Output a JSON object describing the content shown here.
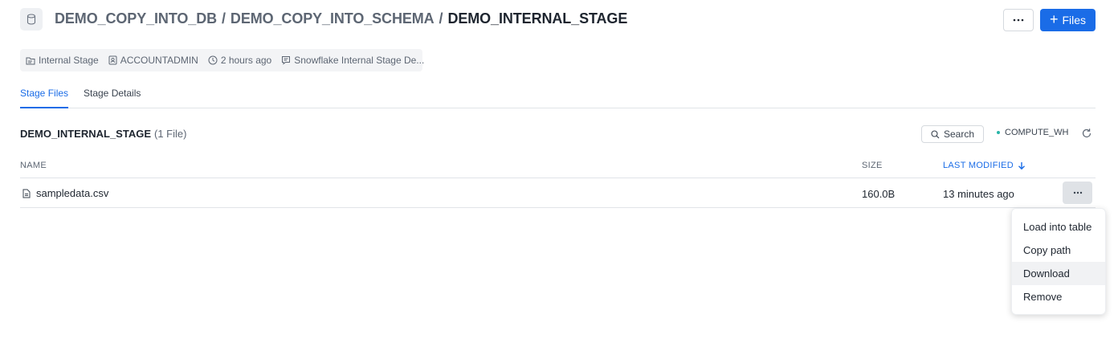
{
  "header": {
    "crumbs": [
      "DEMO_COPY_INTO_DB",
      "DEMO_COPY_INTO_SCHEMA"
    ],
    "separator": "/",
    "current": "DEMO_INTERNAL_STAGE",
    "more_label": "···",
    "files_button": {
      "icon": "+",
      "label": "Files"
    }
  },
  "meta": {
    "type": "Internal Stage",
    "owner": "ACCOUNTADMIN",
    "created": "2 hours ago",
    "comment": "Snowflake Internal Stage De..."
  },
  "tabs": [
    {
      "label": "Stage Files",
      "active": true
    },
    {
      "label": "Stage Details",
      "active": false
    }
  ],
  "section": {
    "title": "DEMO_INTERNAL_STAGE",
    "count": "(1 File)",
    "search_label": "Search",
    "warehouse": "COMPUTE_WH"
  },
  "table": {
    "columns": {
      "name": "NAME",
      "size": "SIZE",
      "modified": "LAST MODIFIED"
    },
    "rows": [
      {
        "name": "sampledata.csv",
        "size": "160.0B",
        "modified": "13 minutes ago"
      }
    ]
  },
  "row_menu": {
    "items": [
      "Load into table",
      "Copy path",
      "Download",
      "Remove"
    ],
    "highlighted": "Download"
  },
  "colors": {
    "accent": "#1a6ce7",
    "warehouse_dot": "#29b5a8"
  }
}
